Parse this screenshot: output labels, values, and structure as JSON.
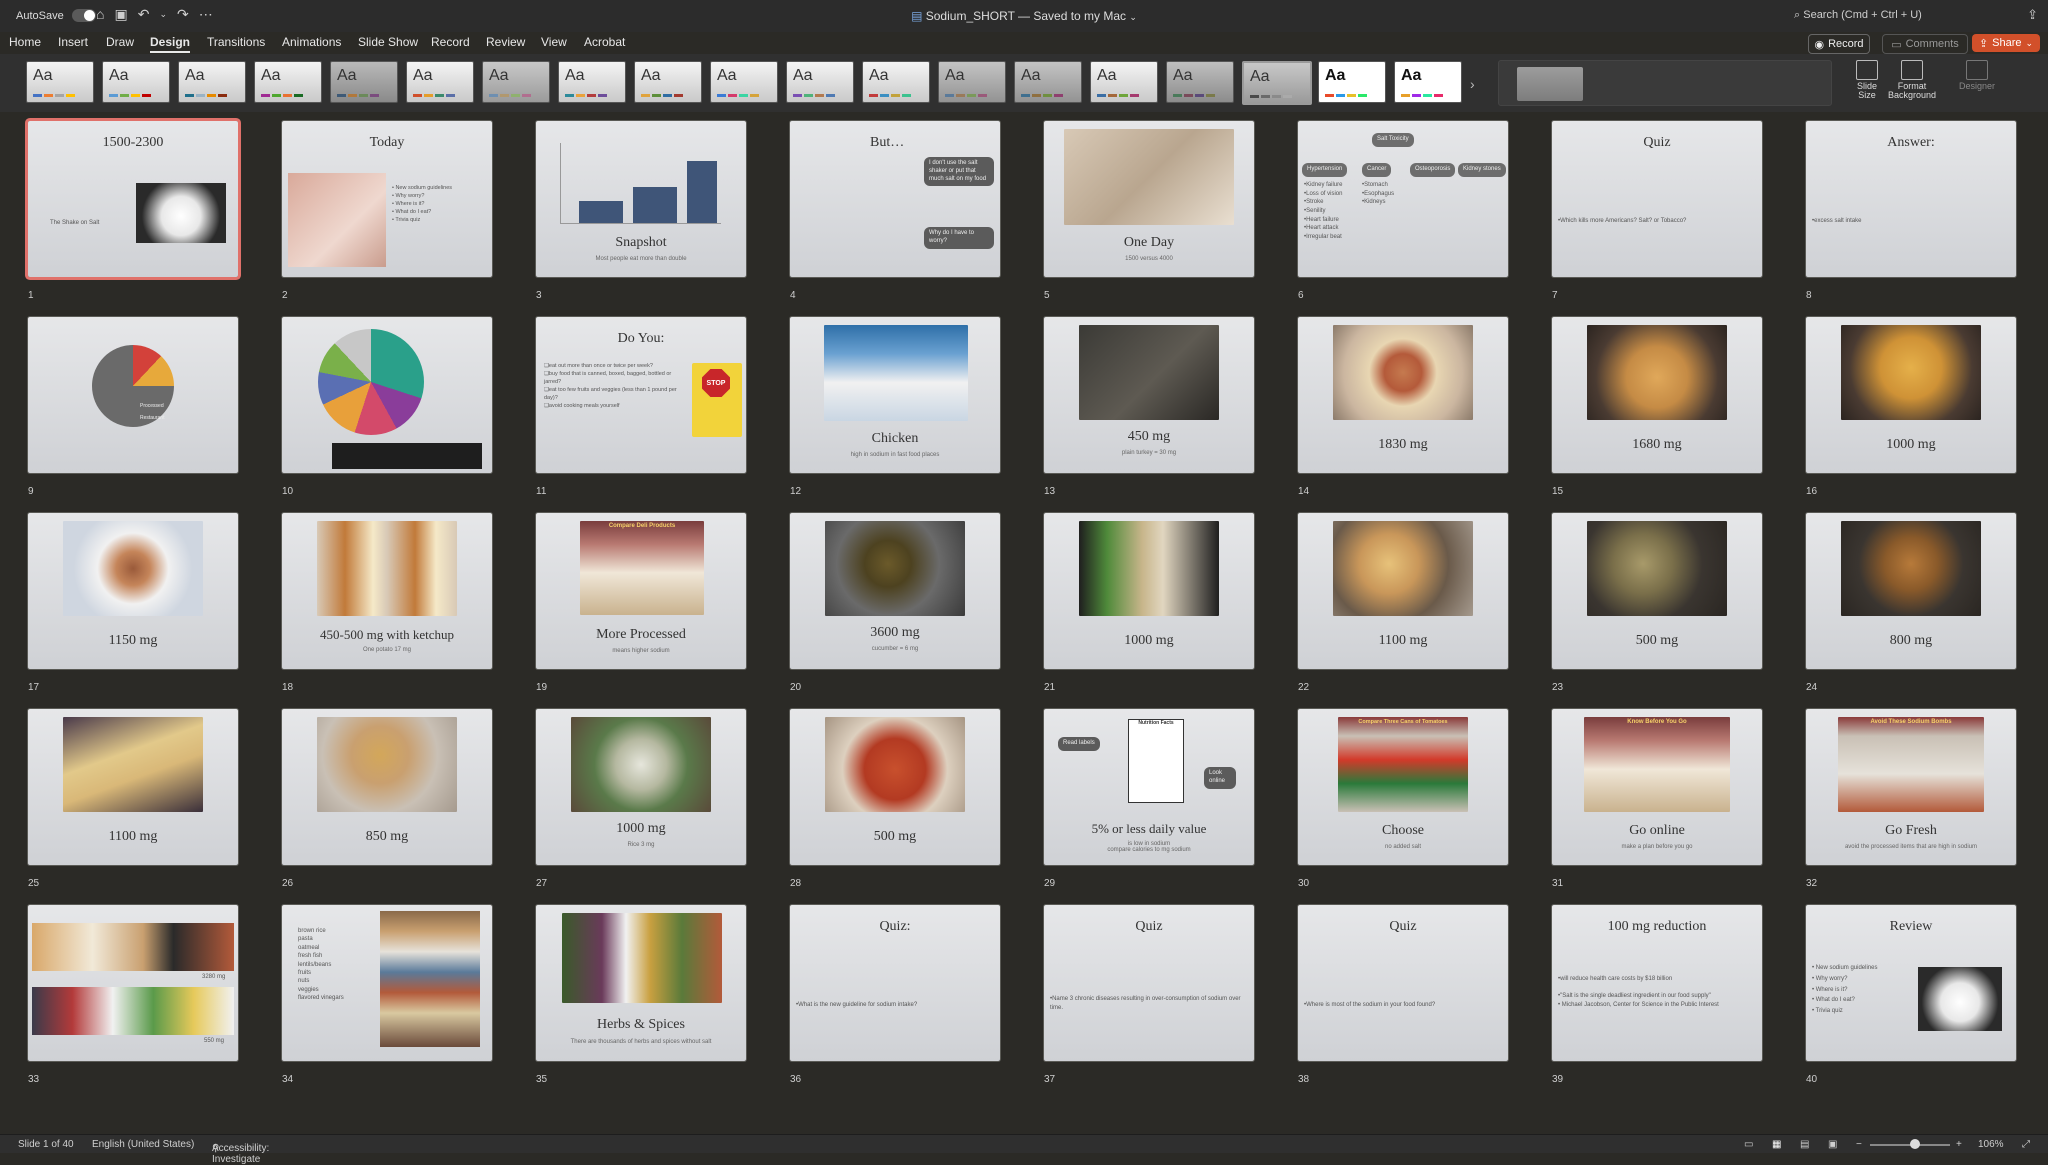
{
  "titlebar": {
    "autosave_label": "AutoSave",
    "document_title": "Sodium_SHORT — Saved to my Mac",
    "search_placeholder": "Search (Cmd + Ctrl + U)"
  },
  "ribbon": {
    "tabs": [
      "Home",
      "Insert",
      "Draw",
      "Design",
      "Transitions",
      "Animations",
      "Slide Show",
      "Record",
      "Review",
      "View",
      "Acrobat"
    ],
    "active_tab": "Design",
    "record_label": "Record",
    "comments_label": "Comments",
    "share_label": "Share",
    "theme_label": "Aa",
    "slide_size_label": "Slide Size",
    "format_background_label": "Format Background",
    "designer_label": "Designer"
  },
  "slides": [
    {
      "n": "1",
      "title": "1500-2300",
      "selected": true,
      "body": "The Shake on Salt"
    },
    {
      "n": "2",
      "title": "Today",
      "body": "• New sodium guidelines\n• Why worry?\n• Where is it?\n• What do I eat?\n• Trivia quiz"
    },
    {
      "n": "3",
      "title": "Snapshot",
      "sub": "Most people eat more than double"
    },
    {
      "n": "4",
      "title": "But…",
      "bubble1": "I don't use the salt shaker or put that much salt on my food",
      "bubble2": "Why do I have to worry?"
    },
    {
      "n": "5",
      "title": "One Day",
      "sub": "1500 versus 4000"
    },
    {
      "n": "6",
      "title": "Salt Toxicity",
      "boxes": [
        "Hypertension",
        "Cancer",
        "Osteoporosis",
        "Kidney stones"
      ],
      "col1": "•Kidney failure\n•Loss of vision\n•Stroke\n•Senility\n•Heart failure\n•Heart attack\n•Irregular beat",
      "col2": "•Stomach\n•Esophagus\n•Kidneys"
    },
    {
      "n": "7",
      "title": "Quiz",
      "body": "•Which kills more Americans? Salt? or Tobacco?"
    },
    {
      "n": "8",
      "title": "Answer:",
      "body": "•excess salt intake"
    },
    {
      "n": "9",
      "pie_labels": [
        "Processed",
        "Restaurant"
      ]
    },
    {
      "n": "10"
    },
    {
      "n": "11",
      "title": "Do You:",
      "body": "❑eat out more than once or twice per week?\n❑buy food that is canned, boxed, bagged, bottled or jarred?\n❑eat too few fruits and veggies (less than 1 pound per day)?\n❑avoid cooking meals yourself",
      "sign": "STOP"
    },
    {
      "n": "12",
      "title": "Chicken",
      "sub": "high in sodium in fast food places"
    },
    {
      "n": "13",
      "title": "450 mg",
      "sub": "plain turkey = 30 mg"
    },
    {
      "n": "14",
      "title": "1830 mg"
    },
    {
      "n": "15",
      "title": "1680 mg"
    },
    {
      "n": "16",
      "title": "1000 mg"
    },
    {
      "n": "17",
      "title": "1150 mg"
    },
    {
      "n": "18",
      "title": "450-500 mg with ketchup",
      "sub": "One potato 17 mg"
    },
    {
      "n": "19",
      "title": "More Processed",
      "sub": "means higher sodium",
      "banner": "Compare Deli Products"
    },
    {
      "n": "20",
      "title": "3600 mg",
      "sub": "cucumber = 6 mg"
    },
    {
      "n": "21",
      "title": "1000 mg"
    },
    {
      "n": "22",
      "title": "1100 mg"
    },
    {
      "n": "23",
      "title": "500 mg"
    },
    {
      "n": "24",
      "title": "800 mg"
    },
    {
      "n": "25",
      "title": "1100 mg"
    },
    {
      "n": "26",
      "title": "850 mg"
    },
    {
      "n": "27",
      "title": "1000 mg",
      "sub": "Rice 3 mg"
    },
    {
      "n": "28",
      "title": "500 mg"
    },
    {
      "n": "29",
      "title": "5% or less daily value",
      "sub": "is low in sodium\ncompare calories to mg sodium",
      "bubble1": "Read labels",
      "bubble2": "Look online",
      "panel": "Nutrition Facts"
    },
    {
      "n": "30",
      "title": "Choose",
      "sub": "no added salt",
      "banner": "Compare Three Cans of Tomatoes"
    },
    {
      "n": "31",
      "title": "Go online",
      "sub": "make a plan before you go",
      "banner": "Know Before You Go"
    },
    {
      "n": "32",
      "title": "Go Fresh",
      "sub": "avoid the processed items that are high in sodium",
      "banner": "Avoid These Sodium Bombs"
    },
    {
      "n": "33",
      "labels": [
        "3280 mg",
        "550 mg"
      ]
    },
    {
      "n": "34",
      "body": "brown rice\npasta\noatmeal\nfresh fish\nlentils/beans\nfruits\nnuts\nveggies\nflavored vinegars"
    },
    {
      "n": "35",
      "title": "Herbs & Spices",
      "sub": "There are thousands of herbs and spices without salt"
    },
    {
      "n": "36",
      "title": "Quiz:",
      "body": "•What is the new guideline for sodium intake?"
    },
    {
      "n": "37",
      "title": "Quiz",
      "body": "•Name 3 chronic diseases resulting in over-consumption of sodium over time."
    },
    {
      "n": "38",
      "title": "Quiz",
      "body": "•Where is most of the sodium in your food found?"
    },
    {
      "n": "39",
      "title": "100 mg reduction",
      "body": "•will reduce health care costs by $18 billion\n\n•\"Salt is the single deadliest ingredient in our food supply\"\n• Michael Jacobson, Center for Science in the Public Interest"
    },
    {
      "n": "40",
      "title": "Review",
      "body": "• New sodium guidelines\n• Why worry?\n• Where is it?\n• What do I eat?\n• Trivia quiz"
    }
  ],
  "statusbar": {
    "slide_indicator": "Slide 1 of 40",
    "language": "English (United States)",
    "accessibility": "Accessibility: Investigate",
    "zoom": "106%"
  }
}
